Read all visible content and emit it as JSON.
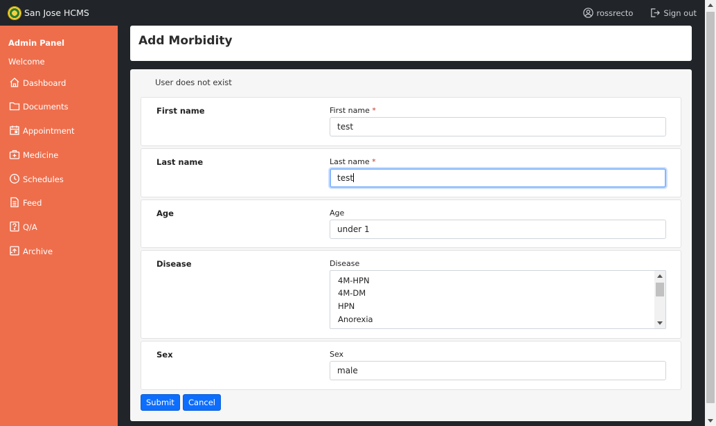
{
  "navbar": {
    "brand": "San Jose HCMS",
    "user": "rossrecto",
    "signout": "Sign out"
  },
  "sidebar": {
    "title": "Admin Panel",
    "welcome": "Welcome",
    "items": [
      {
        "label": "Dashboard",
        "icon": "home-icon"
      },
      {
        "label": "Documents",
        "icon": "folder-icon"
      },
      {
        "label": "Appointment",
        "icon": "calendar-icon"
      },
      {
        "label": "Medicine",
        "icon": "medical-kit-icon"
      },
      {
        "label": "Schedules",
        "icon": "clock-icon"
      },
      {
        "label": "Feed",
        "icon": "document-icon"
      },
      {
        "label": "Q/A",
        "icon": "question-icon"
      },
      {
        "label": "Archive",
        "icon": "archive-icon"
      }
    ]
  },
  "page": {
    "title": "Add Morbidity",
    "notice": "User does not exist"
  },
  "form": {
    "first_name": {
      "section": "First name",
      "label": "First name",
      "required": "*",
      "value": "test"
    },
    "last_name": {
      "section": "Last name",
      "label": "Last name",
      "required": "*",
      "value": "test"
    },
    "age": {
      "section": "Age",
      "label": "Age",
      "value": "under 1"
    },
    "disease": {
      "section": "Disease",
      "label": "Disease",
      "options": [
        "4M-HPN",
        "4M-DM",
        "HPN",
        "Anorexia"
      ]
    },
    "sex": {
      "section": "Sex",
      "label": "Sex",
      "value": "male"
    },
    "submit_label": "Submit",
    "cancel_label": "Cancel"
  },
  "colors": {
    "sidebar_bg": "#ee6e4c",
    "navbar_bg": "#212529",
    "primary_button": "#0d6efd"
  }
}
